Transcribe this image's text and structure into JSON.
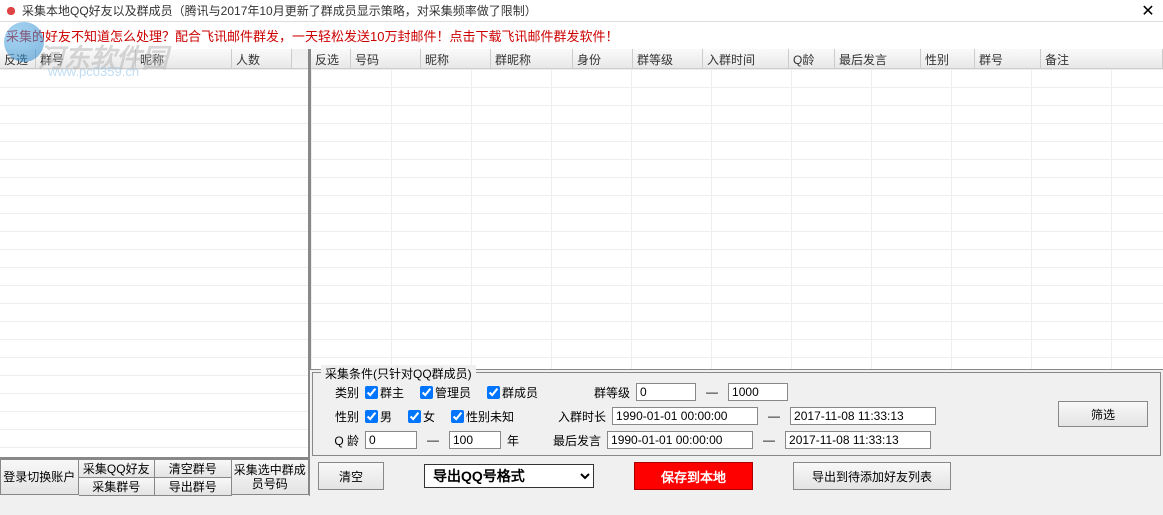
{
  "titlebar": {
    "title": "采集本地QQ好友以及群成员（腾讯与2017年10月更新了群成员显示策略，对采集频率做了限制）"
  },
  "promo": "采集的好友不知道怎么处理？配合飞讯邮件群发，一天轻松发送10万封邮件！点击下载飞讯邮件群发软件！",
  "watermark": {
    "text1": "河东软件园",
    "text2": "www.pc0359.cn"
  },
  "left_table": {
    "headers": [
      "反选",
      "群号",
      "昵称",
      "人数"
    ]
  },
  "right_table": {
    "headers": [
      "反选",
      "号码",
      "昵称",
      "群昵称",
      "身份",
      "群等级",
      "入群时间",
      "Q龄",
      "最后发言",
      "性别",
      "群号",
      "备注"
    ]
  },
  "left_buttons": {
    "b1": "登录切换账户",
    "b2a": "采集QQ好友",
    "b2b": "采集群号",
    "b3a": "清空群号",
    "b3b": "导出群号",
    "b4": "采集选中群成员号码"
  },
  "filter": {
    "legend": "采集条件(只针对QQ群成员)",
    "row1_label": "类别",
    "chk_owner": "群主",
    "chk_admin": "管理员",
    "chk_member": "群成员",
    "row2_label": "性别",
    "chk_male": "男",
    "chk_female": "女",
    "chk_unknown": "性别未知",
    "row3_label": "Q 龄",
    "age_from": "0",
    "age_to": "100",
    "age_unit": "年",
    "level_label": "群等级",
    "level_from": "0",
    "level_to": "1000",
    "join_label": "入群时长",
    "join_from": "1990-01-01 00:00:00",
    "join_to": "2017-11-08 11:33:13",
    "last_label": "最后发言",
    "last_from": "1990-01-01 00:00:00",
    "last_to": "2017-11-08 11:33:13",
    "filter_btn": "筛选"
  },
  "bottom": {
    "clear": "清空",
    "format": "导出QQ号格式",
    "save": "保存到本地",
    "export": "导出到待添加好友列表"
  }
}
